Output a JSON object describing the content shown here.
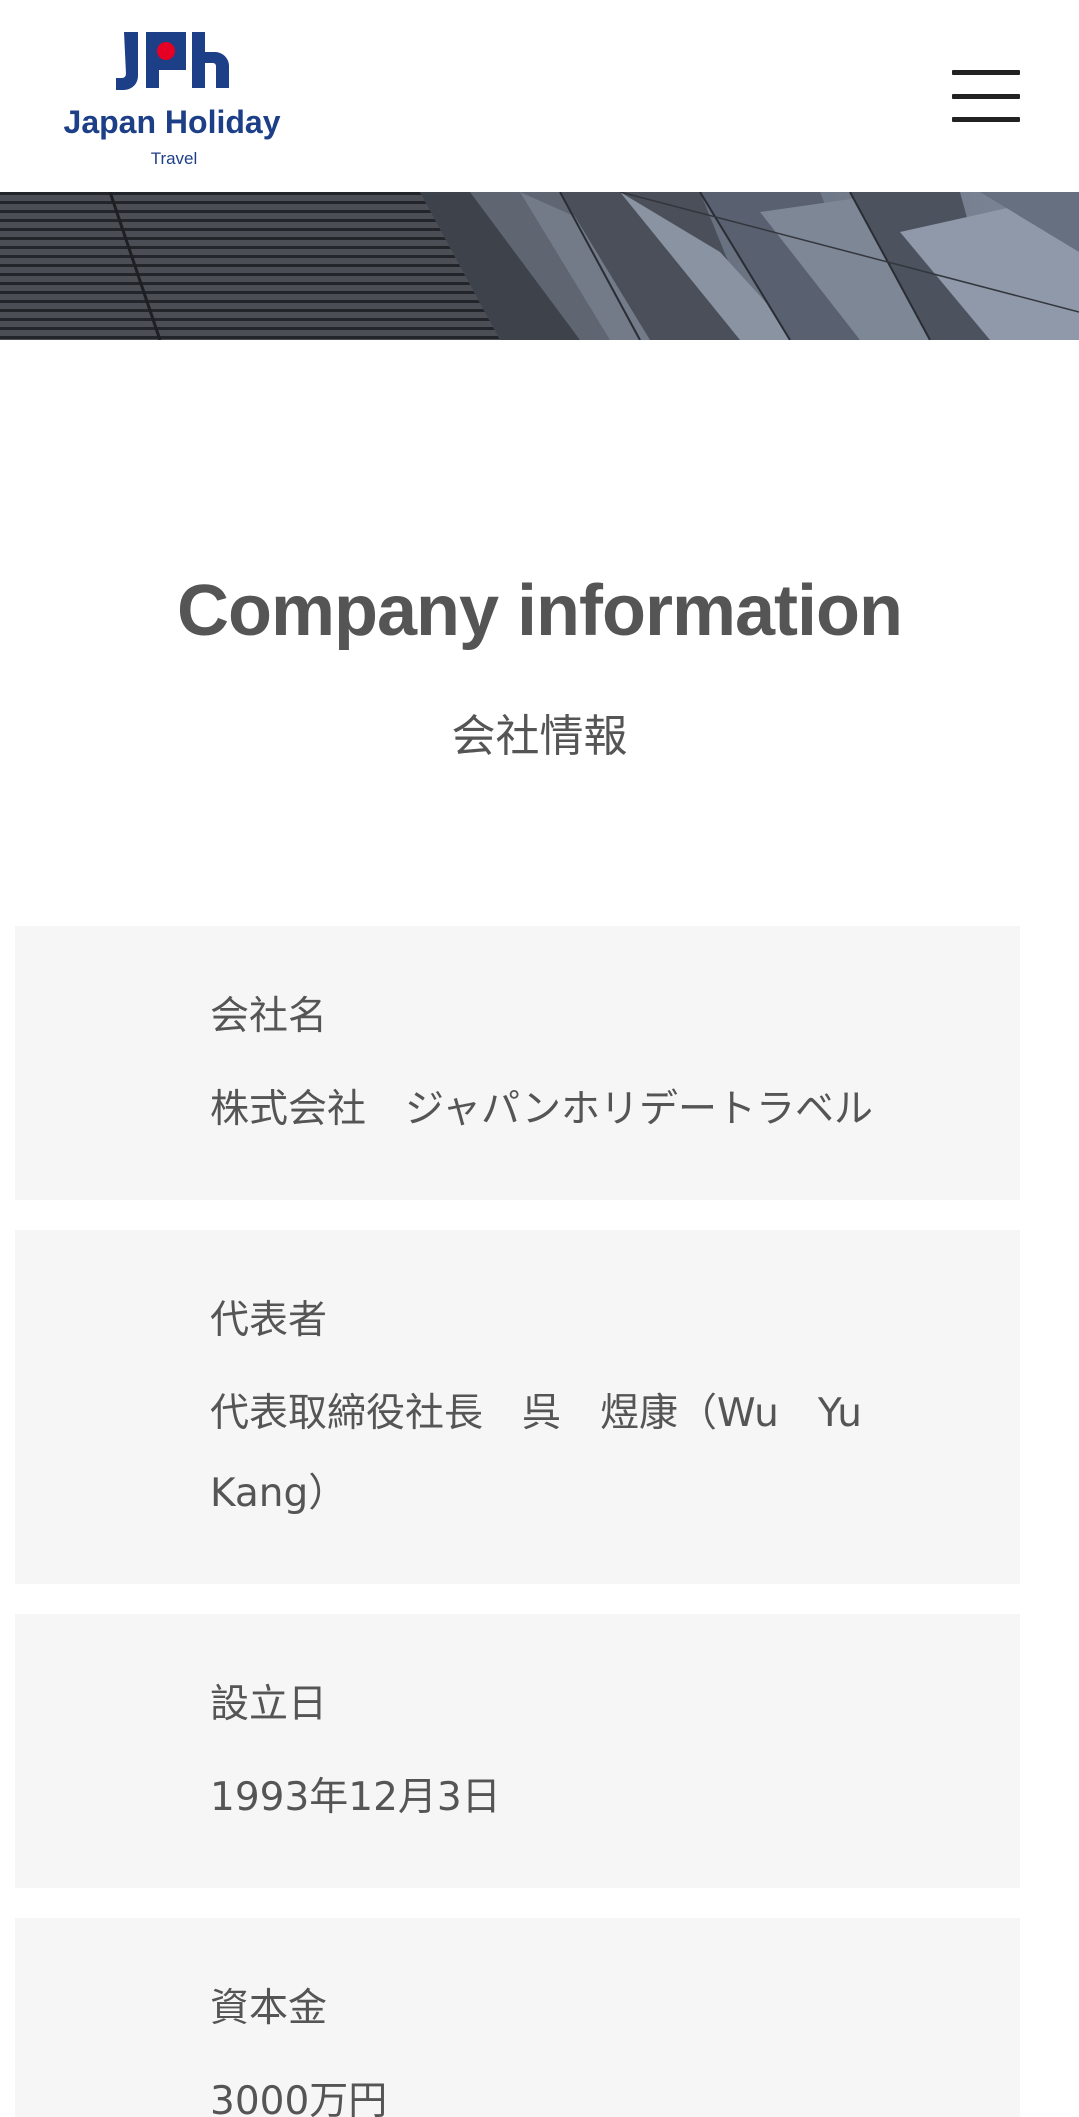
{
  "header": {
    "logo": {
      "mark_text": "Jph",
      "brand_name": "Japan Holiday",
      "tagline": "Travel",
      "colors": {
        "navy": "#1d3f87",
        "red": "#e60023"
      }
    },
    "menu_icon": "hamburger-menu-icon"
  },
  "hero": {
    "image": "dark-architectural-facade-banner"
  },
  "main": {
    "title": "Company information",
    "subtitle": "会社情報",
    "rows": [
      {
        "label": "会社名",
        "value": "株式会社　ジャパンホリデートラベル"
      },
      {
        "label": "代表者",
        "value": "代表取締役社長　呉　煜康（Wu　Yu Kang）"
      },
      {
        "label": "設立日",
        "value": "1993年12月3日"
      },
      {
        "label": "資本金",
        "value": "3000万円"
      }
    ]
  },
  "colors": {
    "text": "#555555",
    "row_background": "#f6f6f6",
    "menu_icon": "#222222"
  }
}
